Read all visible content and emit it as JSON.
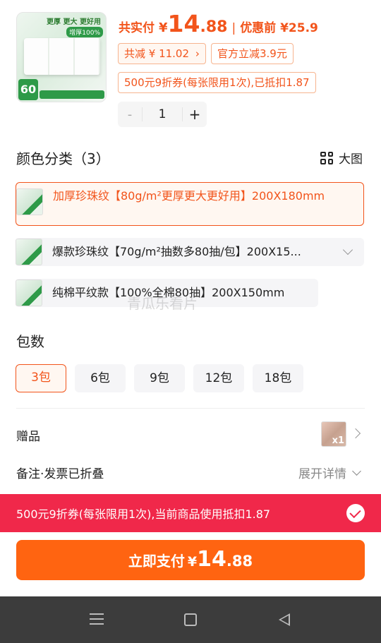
{
  "product": {
    "thumb_tag_top": "更厚 更大 更好用",
    "thumb_tag_badge": "增厚100%",
    "thumb_count": "60",
    "total_pay_label": "共实付",
    "currency": "¥",
    "price_int": "14",
    "price_dec": ".88",
    "separator": "|",
    "original_price": "优惠前 ¥25.9",
    "total_saving": "共减 ¥ 11.02",
    "official_discount": "官方立减3.9元",
    "coupon_info": "500元9折券(每张限用1次),已抵扣1.87",
    "quantity": "1",
    "minus_label": "-",
    "plus_label": "+"
  },
  "color_section": {
    "title": "颜色分类（3）",
    "big_view_label": "大图",
    "options": [
      {
        "label": "加厚珍珠纹【80g/m²更厚更大更好用】200X180mm",
        "selected": true
      },
      {
        "label": "爆款珍珠纹【70g/m²抽数多80抽/包】200X15...",
        "selected": false
      },
      {
        "label": "纯棉平纹款【100%全棉80抽】200X150mm",
        "selected": false
      }
    ],
    "watermark": "青瓜乐看片"
  },
  "pack_section": {
    "title": "包数",
    "options": [
      {
        "label": "3包",
        "selected": true
      },
      {
        "label": "6包",
        "selected": false
      },
      {
        "label": "9包",
        "selected": false
      },
      {
        "label": "12包",
        "selected": false
      },
      {
        "label": "18包",
        "selected": false
      }
    ]
  },
  "gift": {
    "label": "赠品",
    "badge": "x1"
  },
  "remark": {
    "label": "备注·发票已折叠",
    "expand_label": "展开详情"
  },
  "coupon_bar": {
    "text": "500元9折券(每张限用1次),当前商品使用抵扣1.87"
  },
  "pay_button": {
    "label": "立即支付",
    "currency": "¥",
    "price_int": "14",
    "price_dec": ".88"
  },
  "colors": {
    "accent": "#f2541b",
    "pay_button": "#ff6411",
    "coupon_bar": "#f0284a"
  }
}
